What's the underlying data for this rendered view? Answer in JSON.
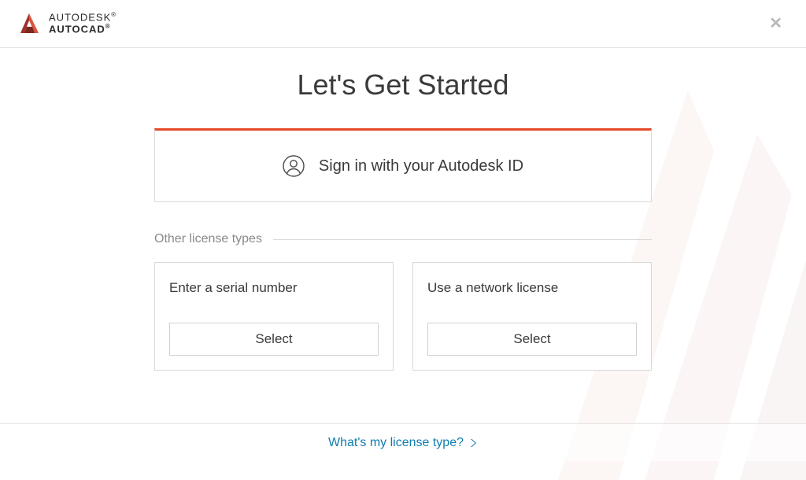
{
  "brand": {
    "company": "AUTODESK",
    "product": "AUTOCAD",
    "accent_color": "#e54a29"
  },
  "title": "Let's Get Started",
  "signin": {
    "label": "Sign in with your Autodesk ID"
  },
  "other_licenses": {
    "legend": "Other license types",
    "cards": [
      {
        "title": "Enter a serial number",
        "button": "Select"
      },
      {
        "title": "Use a network license",
        "button": "Select"
      }
    ]
  },
  "footer": {
    "help_link": "What's my license type?"
  }
}
